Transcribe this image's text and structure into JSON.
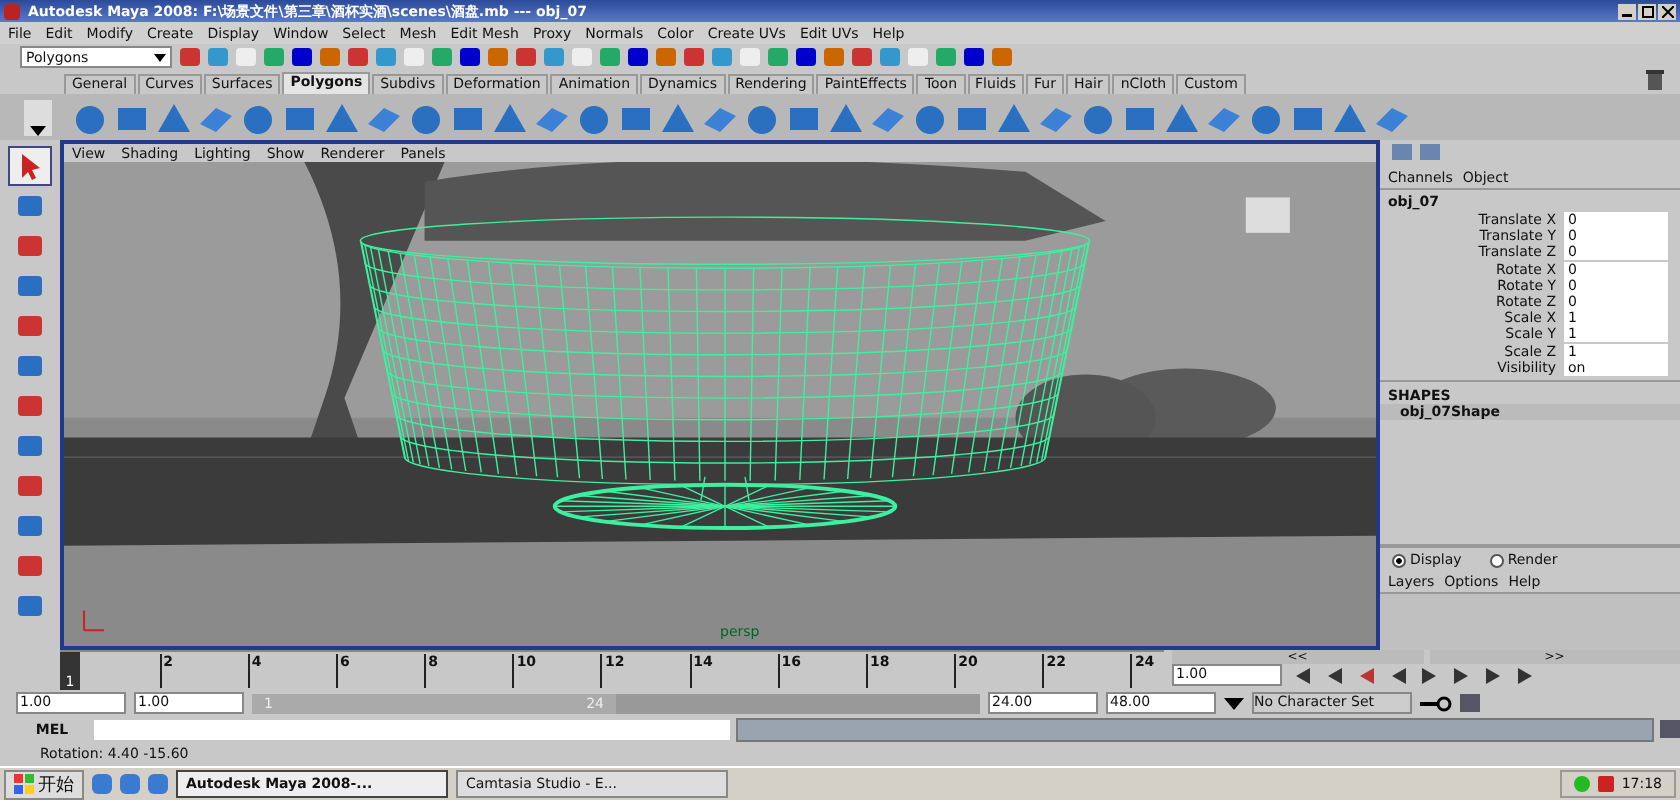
{
  "window": {
    "title": "Autodesk Maya 2008: F:\\场景文件\\第三章\\酒杯实酒\\scenes\\酒盘.mb  ---  obj_07"
  },
  "menu_bar": [
    "File",
    "Edit",
    "Modify",
    "Create",
    "Display",
    "Window",
    "Select",
    "Mesh",
    "Edit Mesh",
    "Proxy",
    "Normals",
    "Color",
    "Create UVs",
    "Edit UVs",
    "Help"
  ],
  "menu_set": "Polygons",
  "shelf_tabs": [
    {
      "label": "General",
      "selected": false
    },
    {
      "label": "Curves",
      "selected": false
    },
    {
      "label": "Surfaces",
      "selected": false
    },
    {
      "label": "Polygons",
      "selected": true
    },
    {
      "label": "Subdivs",
      "selected": false
    },
    {
      "label": "Deformation",
      "selected": false
    },
    {
      "label": "Animation",
      "selected": false
    },
    {
      "label": "Dynamics",
      "selected": false
    },
    {
      "label": "Rendering",
      "selected": false
    },
    {
      "label": "PaintEffects",
      "selected": false
    },
    {
      "label": "Toon",
      "selected": false
    },
    {
      "label": "Fluids",
      "selected": false
    },
    {
      "label": "Fur",
      "selected": false
    },
    {
      "label": "Hair",
      "selected": false
    },
    {
      "label": "nCloth",
      "selected": false
    },
    {
      "label": "Custom",
      "selected": false
    }
  ],
  "viewport": {
    "menus": [
      "View",
      "Shading",
      "Lighting",
      "Show",
      "Renderer",
      "Panels"
    ],
    "camera_label": "persp"
  },
  "channel_box": {
    "tabs": [
      "Channels",
      "Object"
    ],
    "object": "obj_07",
    "attributes": [
      {
        "name": "Translate X",
        "value": "0"
      },
      {
        "name": "Translate Y",
        "value": "0"
      },
      {
        "name": "Translate Z",
        "value": "0"
      },
      {
        "name": "Rotate X",
        "value": "0"
      },
      {
        "name": "Rotate Y",
        "value": "0"
      },
      {
        "name": "Rotate Z",
        "value": "0"
      },
      {
        "name": "Scale X",
        "value": "1"
      },
      {
        "name": "Scale Y",
        "value": "1"
      },
      {
        "name": "Scale Z",
        "value": "1"
      },
      {
        "name": "Visibility",
        "value": "on"
      }
    ],
    "shapes_heading": "SHAPES",
    "shape": "obj_07Shape"
  },
  "layer_editor": {
    "modes": [
      {
        "label": "Display",
        "selected": true
      },
      {
        "label": "Render",
        "selected": false
      }
    ],
    "menus": [
      "Layers",
      "Options",
      "Help"
    ]
  },
  "time_slider": {
    "level": 0,
    "ticks": [
      "2",
      "4",
      "6",
      "8",
      "10",
      "12",
      "14",
      "16",
      "18",
      "20",
      "22",
      "24"
    ],
    "current_frame": "1",
    "current_time": "1.00",
    "back_label": "<<",
    "forward_label": ">>"
  },
  "range_slider": {
    "start_time": "1.00",
    "playback_start": "1.00",
    "level": 0.5,
    "range_start": "1",
    "range_end": "24",
    "playback_end": "24.00",
    "end_time": "48.00",
    "character_set": "No Character Set"
  },
  "command_line": {
    "label": "MEL"
  },
  "help_line": "Rotation:  4.40   -15.60",
  "taskbar": {
    "start": "开始",
    "tasks": [
      {
        "label": "Autodesk Maya 2008-...",
        "selected": true
      },
      {
        "label": "Camtasia Studio - E...",
        "selected": false
      }
    ],
    "clock": "17:18"
  }
}
